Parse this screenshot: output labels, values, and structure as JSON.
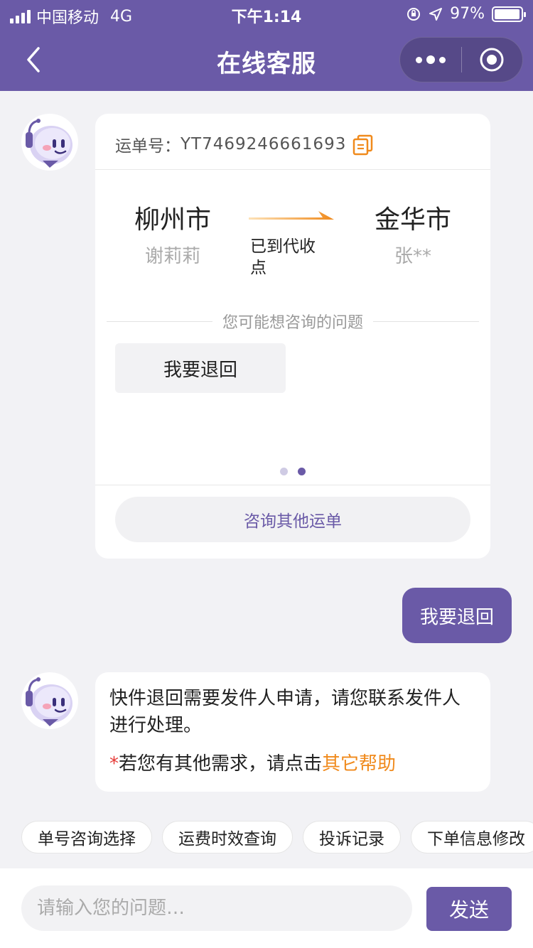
{
  "status_bar": {
    "carrier": "中国移动",
    "network": "4G",
    "time": "下午1:14",
    "battery_percent": "97%",
    "battery_level": 0.97
  },
  "nav": {
    "title": "在线客服"
  },
  "card": {
    "waybill_label": "运单号：",
    "waybill_number": "YT7469246661693",
    "from_city": "柳州市",
    "from_person": "谢莉莉",
    "to_city": "金华市",
    "to_person": "张**",
    "status": "已到代收点",
    "suggest_title": "您可能想咨询的问题",
    "suggest_option": "我要退回",
    "other_waybill": "咨询其他运单"
  },
  "user_message": "我要退回",
  "bot_reply": {
    "text": "快件退回需要发件人申请，请您联系发件人进行处理。",
    "help_star": "*",
    "help_prefix": "若您有其他需求，请点击",
    "help_link": "其它帮助"
  },
  "quick_chips": [
    "单号咨询选择",
    "运费时效查询",
    "投诉记录",
    "下单信息修改"
  ],
  "input": {
    "placeholder": "请输入您的问题…",
    "send_label": "发送"
  },
  "colors": {
    "brand": "#6a5aa7",
    "accent": "#f08a1c",
    "alert": "#e53935"
  }
}
